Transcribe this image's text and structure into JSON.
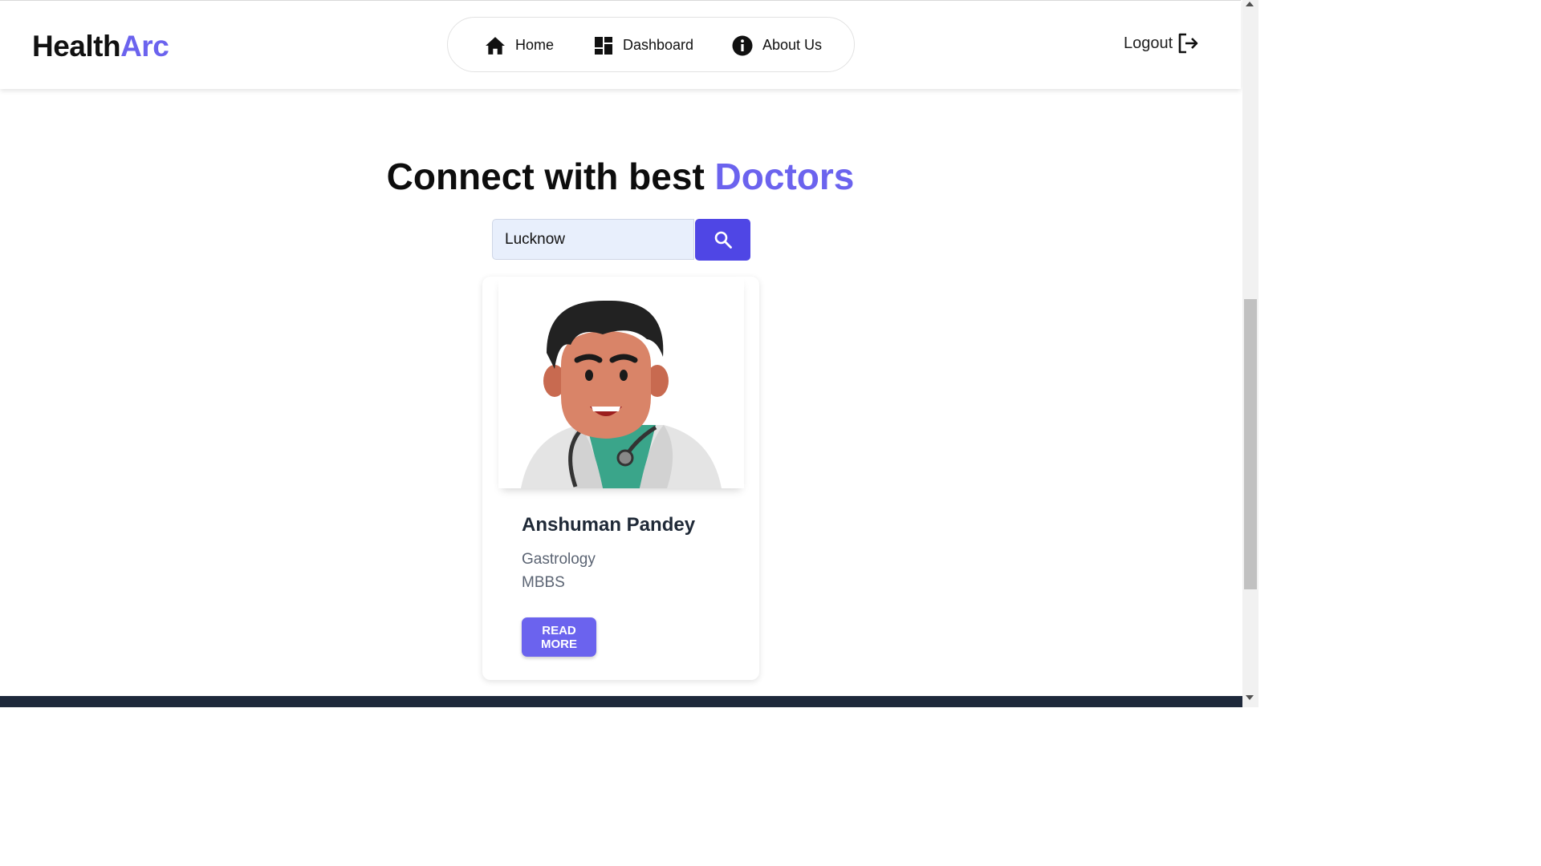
{
  "brand": {
    "part1": "Health",
    "part2": "Arc"
  },
  "nav": {
    "items": [
      {
        "label": "Home",
        "icon": "home-icon"
      },
      {
        "label": "Dashboard",
        "icon": "dashboard-icon"
      },
      {
        "label": "About Us",
        "icon": "info-icon"
      }
    ]
  },
  "logout": {
    "label": "Logout",
    "icon": "logout-icon"
  },
  "hero": {
    "title_part1": "Connect with best",
    "title_part2": "Doctors"
  },
  "search": {
    "value": "Lucknow",
    "button_icon": "search-icon"
  },
  "doctors": [
    {
      "name": "Anshuman Pandey",
      "specialization": "Gastrology",
      "degree": "MBBS",
      "button_label": "READ MORE",
      "image": "doctor-avatar"
    }
  ],
  "colors": {
    "accent": "#6b63ee",
    "button": "#4f46e5",
    "footer": "#1e293b"
  }
}
